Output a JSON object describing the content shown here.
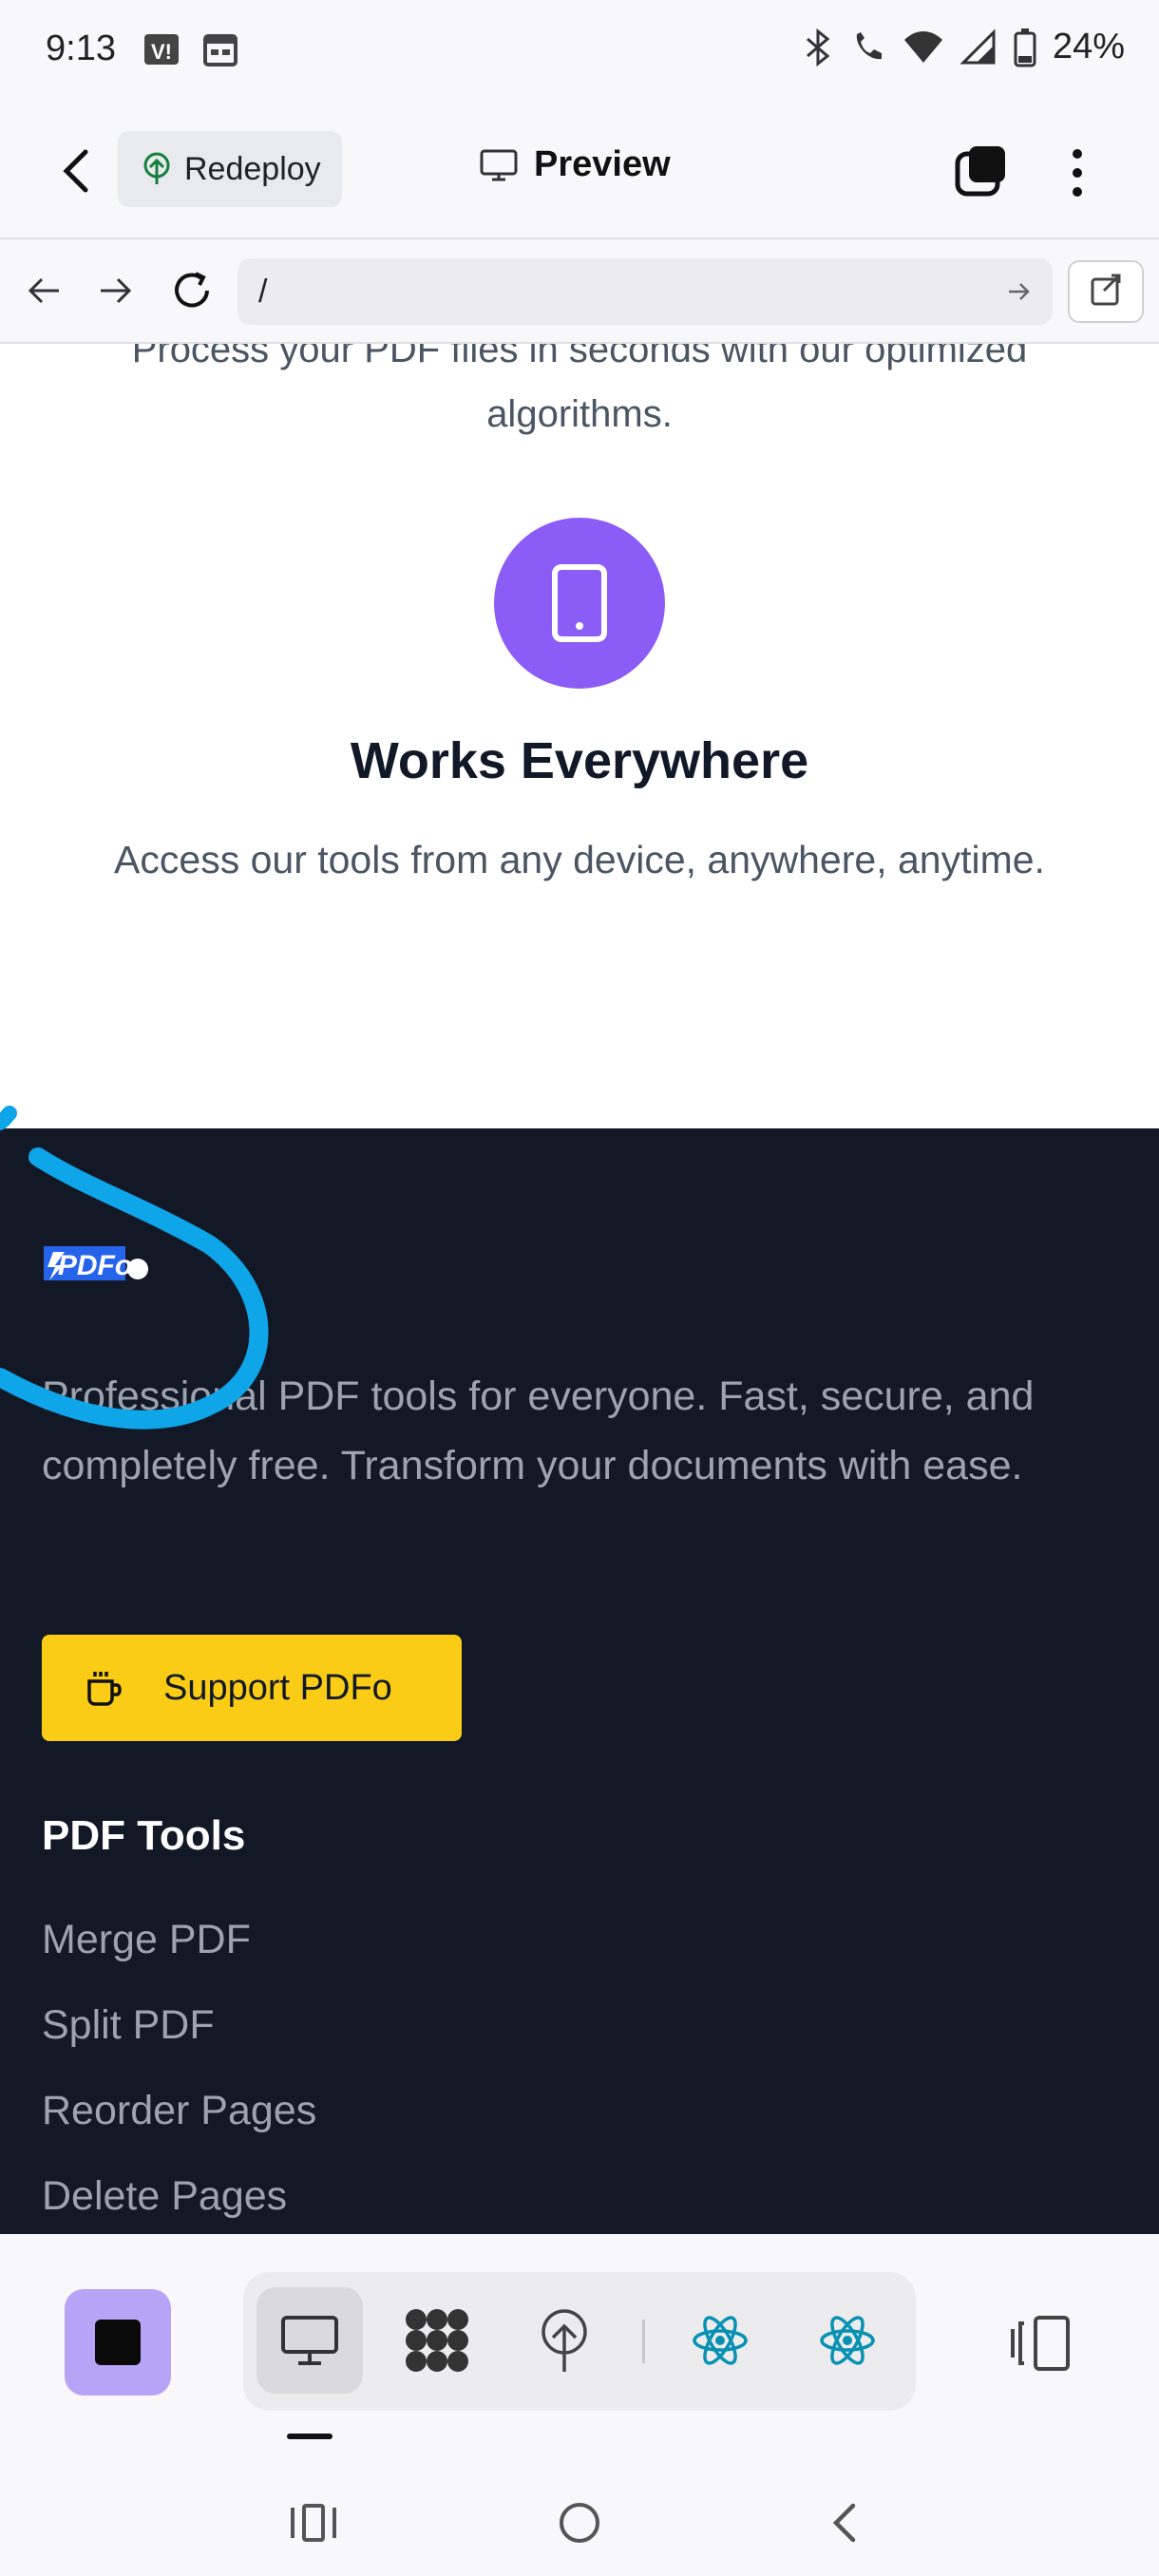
{
  "status_bar": {
    "time": "9:13",
    "battery": "24%",
    "icons": [
      "bluetooth-icon",
      "wifi-call-icon",
      "wifi-icon",
      "signal-icon",
      "battery-icon"
    ]
  },
  "app_header": {
    "redeploy_label": "Redeploy",
    "preview_label": "Preview"
  },
  "url_bar": {
    "url": "/"
  },
  "page": {
    "feature_prev_line1": "Process your PDF files in seconds with our optimized",
    "feature_prev_line2": "algorithms.",
    "feature_title": "Works Everywhere",
    "feature_desc": "Access our tools from any device, anywhere, anytime.",
    "feature_color": "#8b5cf6",
    "footer": {
      "logo_text": "PDFo",
      "description": "Professional PDF tools for everyone. Fast, secure, and completely free. Transform your documents with ease.",
      "support_label": "Support PDFo",
      "tools_heading": "PDF Tools",
      "tools": [
        "Merge PDF",
        "Split PDF",
        "Reorder Pages",
        "Delete Pages"
      ],
      "background": "#121826",
      "support_color": "#facc15"
    }
  },
  "bottom_toolbar": {
    "accent": "#b6a4f7",
    "items": [
      "desktop-icon",
      "apps-icon",
      "deploy-icon",
      "react-icon",
      "react-icon"
    ]
  }
}
